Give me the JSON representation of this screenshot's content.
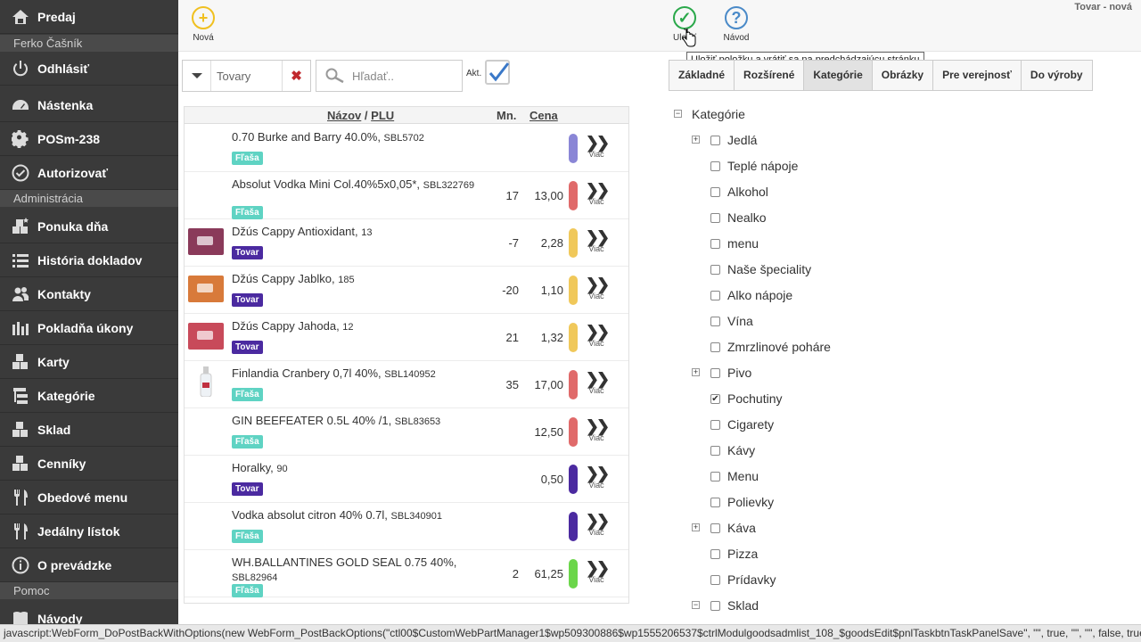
{
  "sidebar": {
    "items": [
      {
        "label": "Predaj",
        "icon": "home-icon"
      },
      {
        "label": "Odhlásiť",
        "icon": "power-icon"
      },
      {
        "label": "Nástenka",
        "icon": "dashboard-icon"
      },
      {
        "label": "POSm-238",
        "icon": "gear-icon"
      },
      {
        "label": "Autorizovať",
        "icon": "check-circle-icon"
      },
      {
        "label": "Ponuka dňa",
        "icon": "boxes-star-icon"
      },
      {
        "label": "História dokladov",
        "icon": "list-icon"
      },
      {
        "label": "Kontakty",
        "icon": "users-icon"
      },
      {
        "label": "Pokladňa úkony",
        "icon": "bars-icon"
      },
      {
        "label": "Karty",
        "icon": "boxes-icon"
      },
      {
        "label": "Kategórie",
        "icon": "tree-icon"
      },
      {
        "label": "Sklad",
        "icon": "boxes-icon"
      },
      {
        "label": "Cenníky",
        "icon": "boxes-icon"
      },
      {
        "label": "Obedové menu",
        "icon": "cutlery-icon"
      },
      {
        "label": "Jedálny lístok",
        "icon": "cutlery-icon"
      },
      {
        "label": "O prevádzke",
        "icon": "info-icon"
      },
      {
        "label": "Návody",
        "icon": "book-icon"
      }
    ],
    "sections": [
      "Ferko Čašník",
      "Administrácia",
      "Pomoc"
    ]
  },
  "toolbar": {
    "new_label": "Nová",
    "save_label": "Uložiť",
    "help_label": "Návod",
    "page_title": "Tovar - nová",
    "tooltip": "Uložiť položku a vrátiť sa na predchádzajúcu stránku"
  },
  "filter": {
    "type_value": "Tovary",
    "search_placeholder": "Hľadať..",
    "akt_label": "Akt."
  },
  "table": {
    "headers": {
      "name": "Názov",
      "sep": "/",
      "plu": "PLU",
      "qty": "Mn.",
      "price": "Cena"
    },
    "more_label": "Viac",
    "rows": [
      {
        "name": "0.70 Burke and Barry 40.0%,",
        "code": "SBL5702",
        "badge": "Fľaša",
        "badge_type": "flasa",
        "qty": "",
        "price": "",
        "color": "#8a86d6",
        "thumb": ""
      },
      {
        "name": "Absolut Vodka Mini Col.40%5x0,05*,",
        "code": "SBL322769",
        "badge": "Fľaša",
        "badge_type": "flasa",
        "qty": "17",
        "price": "13,00",
        "color": "#e06a6a",
        "thumb": ""
      },
      {
        "name": "Džús Cappy Antioxidant,",
        "code": "13",
        "badge": "Tovar",
        "badge_type": "tovar",
        "qty": "-7",
        "price": "2,28",
        "color": "#f0c85a",
        "thumb": "#8a3a5a"
      },
      {
        "name": "Džús Cappy Jablko,",
        "code": "185",
        "badge": "Tovar",
        "badge_type": "tovar",
        "qty": "-20",
        "price": "1,10",
        "color": "#f0c85a",
        "thumb": "#d87a3a"
      },
      {
        "name": "Džús Cappy Jahoda,",
        "code": "12",
        "badge": "Tovar",
        "badge_type": "tovar",
        "qty": "21",
        "price": "1,32",
        "color": "#f0c85a",
        "thumb": "#c84a5a"
      },
      {
        "name": "Finlandia Cranbery 0,7l 40%,",
        "code": "SBL140952",
        "badge": "Fľaša",
        "badge_type": "flasa",
        "qty": "35",
        "price": "17,00",
        "color": "#e06a6a",
        "thumb": "bottle"
      },
      {
        "name": "GIN BEEFEATER 0.5L 40% /1,",
        "code": "SBL83653",
        "badge": "Fľaša",
        "badge_type": "flasa",
        "qty": "",
        "price": "12,50",
        "color": "#e06a6a",
        "thumb": ""
      },
      {
        "name": "Horalky,",
        "code": "90",
        "badge": "Tovar",
        "badge_type": "tovar",
        "qty": "",
        "price": "0,50",
        "color": "#4b2aa0",
        "thumb": ""
      },
      {
        "name": "Vodka absolut citron 40% 0.7l,",
        "code": "SBL340901",
        "badge": "Fľaša",
        "badge_type": "flasa",
        "qty": "",
        "price": "",
        "color": "#4b2aa0",
        "thumb": ""
      },
      {
        "name": "WH.BALLANTINES GOLD SEAL 0.75 40%,",
        "code": "SBL82964",
        "badge": "Fľaša",
        "badge_type": "flasa",
        "qty": "2",
        "price": "61,25",
        "color": "#6bd64a",
        "thumb": ""
      }
    ]
  },
  "tabs": [
    "Základné",
    "Rozšírené",
    "Kategórie",
    "Obrázky",
    "Pre verejnosť",
    "Do výroby"
  ],
  "tree": {
    "root": "Kategórie",
    "items": [
      {
        "label": "Jedlá",
        "expander": "plus",
        "checked": false
      },
      {
        "label": "Teplé nápoje",
        "expander": "",
        "checked": false
      },
      {
        "label": "Alkohol",
        "expander": "",
        "checked": false
      },
      {
        "label": "Nealko",
        "expander": "",
        "checked": false
      },
      {
        "label": "menu",
        "expander": "",
        "checked": false
      },
      {
        "label": "Naše špeciality",
        "expander": "",
        "checked": false
      },
      {
        "label": "Alko nápoje",
        "expander": "",
        "checked": false
      },
      {
        "label": "Vína",
        "expander": "",
        "checked": false
      },
      {
        "label": "Zmrzlinové poháre",
        "expander": "",
        "checked": false
      },
      {
        "label": "Pivo",
        "expander": "plus",
        "checked": false
      },
      {
        "label": "Pochutiny",
        "expander": "",
        "checked": true
      },
      {
        "label": "Cigarety",
        "expander": "",
        "checked": false
      },
      {
        "label": "Kávy",
        "expander": "",
        "checked": false
      },
      {
        "label": "Menu",
        "expander": "",
        "checked": false
      },
      {
        "label": "Polievky",
        "expander": "",
        "checked": false
      },
      {
        "label": "Káva",
        "expander": "plus",
        "checked": false
      },
      {
        "label": "Pizza",
        "expander": "",
        "checked": false
      },
      {
        "label": "Prídavky",
        "expander": "",
        "checked": false
      },
      {
        "label": "Sklad",
        "expander": "minus",
        "checked": false
      }
    ]
  },
  "statusbar": "javascript:WebForm_DoPostBackWithOptions(new WebForm_PostBackOptions(\"ctl00$CustomWebPartManager1$wp509300886$wp1555206537$ctrlModulgoodsadmlist_108_$goodsEdit$pnlTaskbtnTaskPanelSave\", \"\", true, \"\", \"\", false, true))",
  "colors": {
    "sidebar": "#3a3a3a",
    "flasa": "#5fd3c3",
    "tovar": "#4b2aa0",
    "save": "#2aa84a",
    "help": "#4a8ac8",
    "new": "#f0c020"
  }
}
